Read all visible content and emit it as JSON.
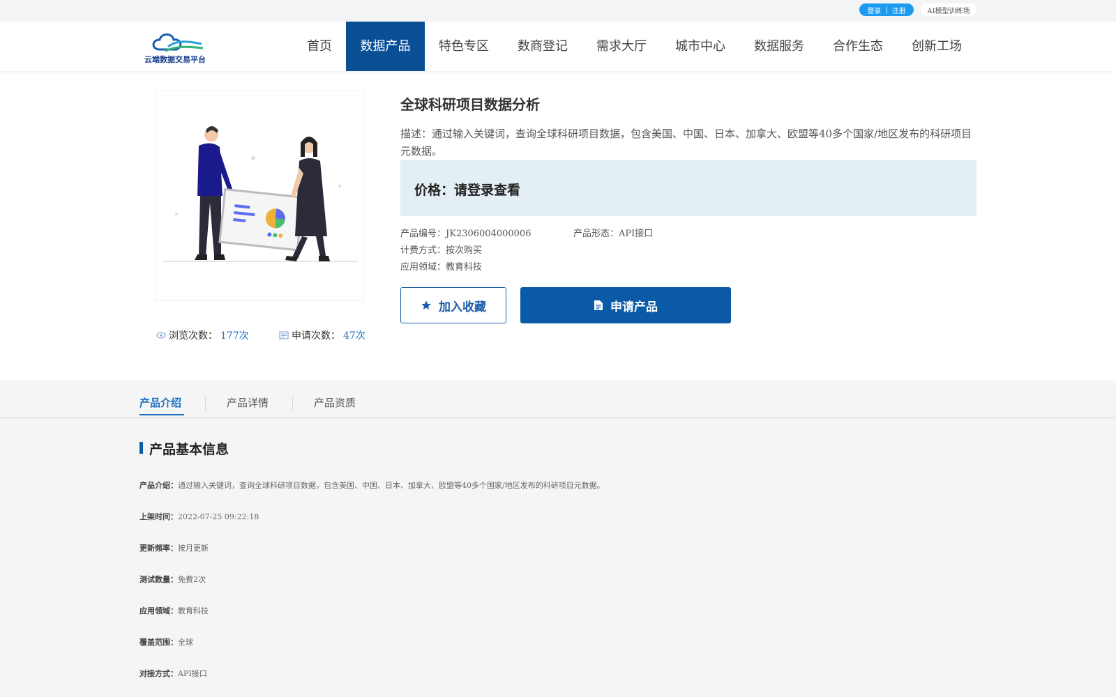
{
  "topbar": {
    "login": "登录",
    "separator": "|",
    "register": "注册",
    "ai_link": "AI模型训练场"
  },
  "header": {
    "logo_text": "云端数据交易平台",
    "nav": [
      {
        "label": "首页",
        "active": false
      },
      {
        "label": "数据产品",
        "active": true
      },
      {
        "label": "特色专区",
        "active": false
      },
      {
        "label": "数商登记",
        "active": false
      },
      {
        "label": "需求大厅",
        "active": false
      },
      {
        "label": "城市中心",
        "active": false
      },
      {
        "label": "数据服务",
        "active": false
      },
      {
        "label": "合作生态",
        "active": false
      },
      {
        "label": "创新工场",
        "active": false
      }
    ]
  },
  "product": {
    "title": "全球科研项目数据分析",
    "description": "描述：通过输入关键词，查询全球科研项目数据，包含美国、中国、日本、加拿大、欧盟等40多个国家/地区发布的科研项目元数据。",
    "price": "价格：请登录查看",
    "code_label": "产品编号：",
    "code": "JK2306004000006",
    "form_label": "产品形态：",
    "form": "API接口",
    "billing_label": "计费方式：",
    "billing": "按次购买",
    "field_label": "应用领域：",
    "field": "教育科技",
    "views_label": "浏览次数：",
    "views": "177次",
    "applies_label": "申请次数：",
    "applies": "47次",
    "fav_button": "加入收藏",
    "apply_button": "申请产品"
  },
  "tabs": [
    "产品介绍",
    "产品详情",
    "产品资质"
  ],
  "section": {
    "title": "产品基本信息",
    "rows": [
      {
        "label": "产品介绍：",
        "value": "通过输入关键词，查询全球科研项目数据，包含美国、中国、日本、加拿大、欧盟等40多个国家/地区发布的科研项目元数据。"
      },
      {
        "label": "上架时间：",
        "value": "2022-07-25 09:22:18"
      },
      {
        "label": "更新频率：",
        "value": "按月更新"
      },
      {
        "label": "测试数量：",
        "value": "免费2次"
      },
      {
        "label": "应用领域：",
        "value": "教育科技"
      },
      {
        "label": "覆盖范围：",
        "value": "全球"
      },
      {
        "label": "对接方式：",
        "value": "API接口"
      }
    ]
  },
  "colors": {
    "primary": "#0a5aa8",
    "nav_active": "#0a4e96",
    "link_blue": "#1e6fc0",
    "price_bg": "#e3eff5",
    "auth_pill": "#1b9bf0"
  }
}
